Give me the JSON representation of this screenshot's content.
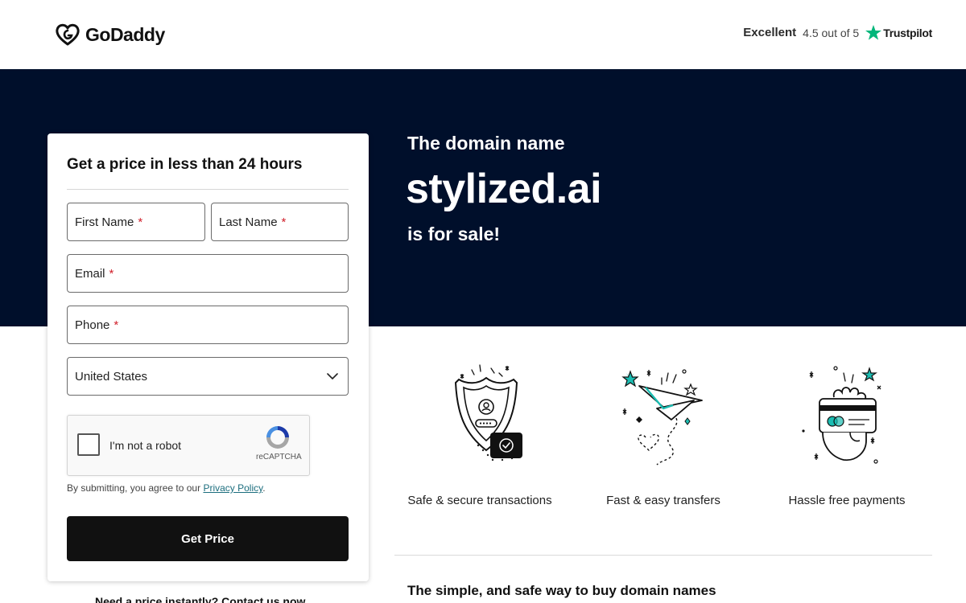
{
  "header": {
    "logo_text": "GoDaddy",
    "rating_word": "Excellent",
    "rating_score": "4.5 out of 5",
    "trustpilot_label": "Trustpilot"
  },
  "hero": {
    "pre": "The domain name",
    "domain": "stylized.ai",
    "post": "is for sale!"
  },
  "form": {
    "title": "Get a price in less than 24 hours",
    "first_name": "First Name",
    "last_name": "Last Name",
    "email": "Email",
    "phone": "Phone",
    "required_mark": "*",
    "country": "United States",
    "captcha_label": "I'm not a robot",
    "captcha_brand": "reCAPTCHA",
    "consent_text": "By submitting, you agree to our",
    "privacy_link": "Privacy Policy",
    "consent_end": ".",
    "submit_label": "Get Price",
    "below_text": "Need a price instantly? Contact us now"
  },
  "features": [
    {
      "label": "Safe & secure transactions",
      "icon": "shield-icon"
    },
    {
      "label": "Fast & easy transfers",
      "icon": "paper-plane-icon"
    },
    {
      "label": "Hassle free payments",
      "icon": "card-payment-icon"
    }
  ],
  "bottom": {
    "heading": "The simple, and safe way to buy domain names"
  },
  "colors": {
    "hero_bg": "#000f2b",
    "button_bg": "#111111",
    "accent_teal": "#1bbdb2",
    "trustpilot_green": "#00b67a",
    "required_red": "#d1202b"
  }
}
